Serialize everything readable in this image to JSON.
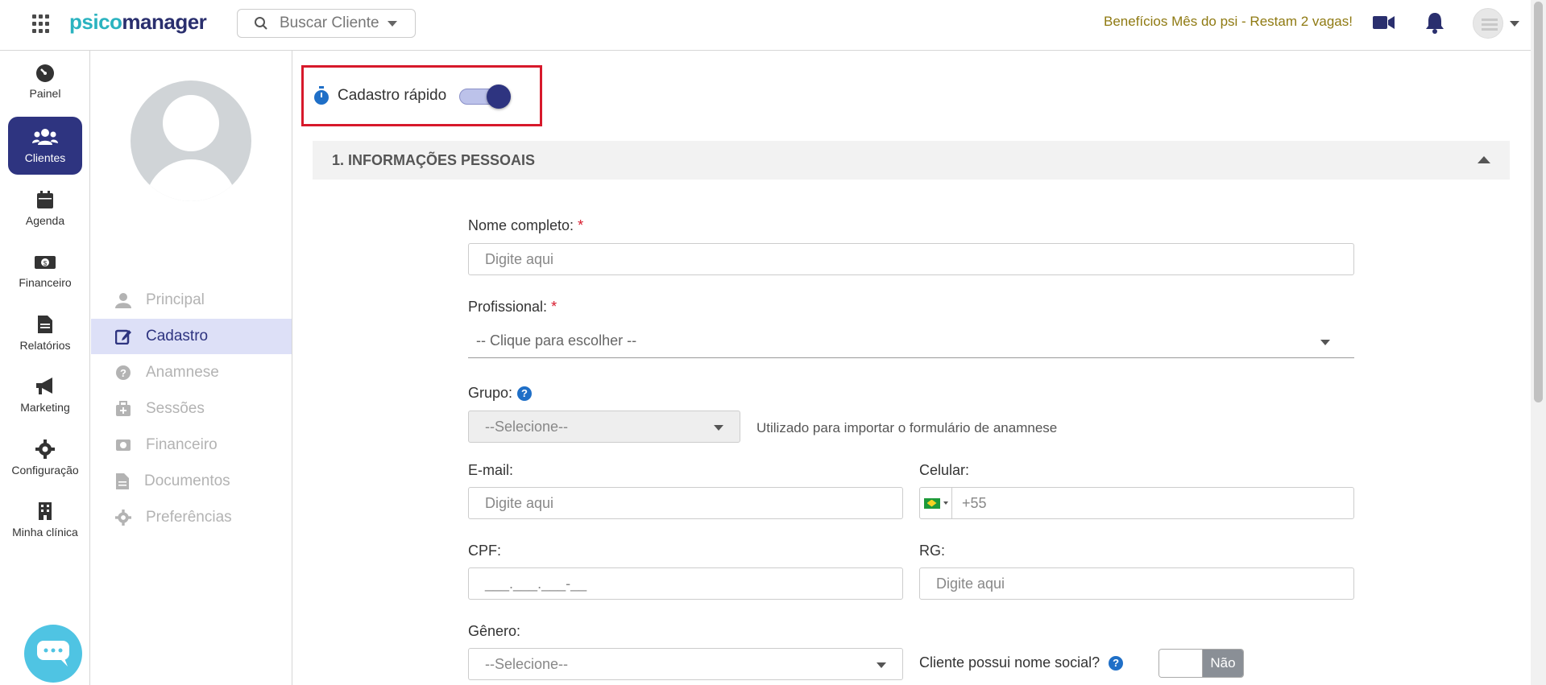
{
  "topbar": {
    "logo_part1": "psico",
    "logo_part2": "manager",
    "search_placeholder": "Buscar Cliente",
    "promo_text": "Benefícios Mês do psi - Restam 2 vagas!"
  },
  "leftnav": {
    "items": [
      {
        "label": "Painel",
        "icon": "gauge-icon"
      },
      {
        "label": "Clientes",
        "icon": "users-icon",
        "active": true
      },
      {
        "label": "Agenda",
        "icon": "calendar-icon"
      },
      {
        "label": "Financeiro",
        "icon": "money-icon"
      },
      {
        "label": "Relatórios",
        "icon": "report-icon"
      },
      {
        "label": "Marketing",
        "icon": "megaphone-icon"
      },
      {
        "label": "Configuração",
        "icon": "gear-icon"
      },
      {
        "label": "Minha clínica",
        "icon": "building-icon"
      }
    ]
  },
  "subnav": {
    "items": [
      {
        "label": "Principal",
        "icon": "user-icon"
      },
      {
        "label": "Cadastro",
        "icon": "edit-icon",
        "active": true
      },
      {
        "label": "Anamnese",
        "icon": "question-icon"
      },
      {
        "label": "Sessões",
        "icon": "medkit-icon"
      },
      {
        "label": "Financeiro",
        "icon": "money-icon"
      },
      {
        "label": "Documentos",
        "icon": "document-icon"
      },
      {
        "label": "Preferências",
        "icon": "gear-icon"
      }
    ]
  },
  "main": {
    "quick_register_label": "Cadastro rápido",
    "quick_register_on": true,
    "section_title": "1. INFORMAÇÕES PESSOAIS",
    "fields": {
      "full_name_label": "Nome completo:",
      "full_name_placeholder": "Digite aqui",
      "professional_label": "Profissional:",
      "professional_placeholder": "-- Clique para escolher --",
      "group_label": "Grupo:",
      "group_value": "--Selecione--",
      "group_hint": "Utilizado para importar o formulário de anamnese",
      "email_label": "E-mail:",
      "email_placeholder": "Digite aqui",
      "phone_label": "Celular:",
      "phone_value": "+55",
      "cpf_label": "CPF:",
      "cpf_mask": "___.___.___-__",
      "rg_label": "RG:",
      "rg_placeholder": "Digite aqui",
      "gender_label": "Gênero:",
      "gender_value": "--Selecione--",
      "social_name_label": "Cliente possui nome social?",
      "social_name_toggle": "Não"
    },
    "required_mark": "*",
    "help_mark": "?"
  },
  "colors": {
    "primary": "#2e3480",
    "accent": "#2bb3c0",
    "highlight_border": "#d7192b",
    "promo": "#8f7a12"
  }
}
